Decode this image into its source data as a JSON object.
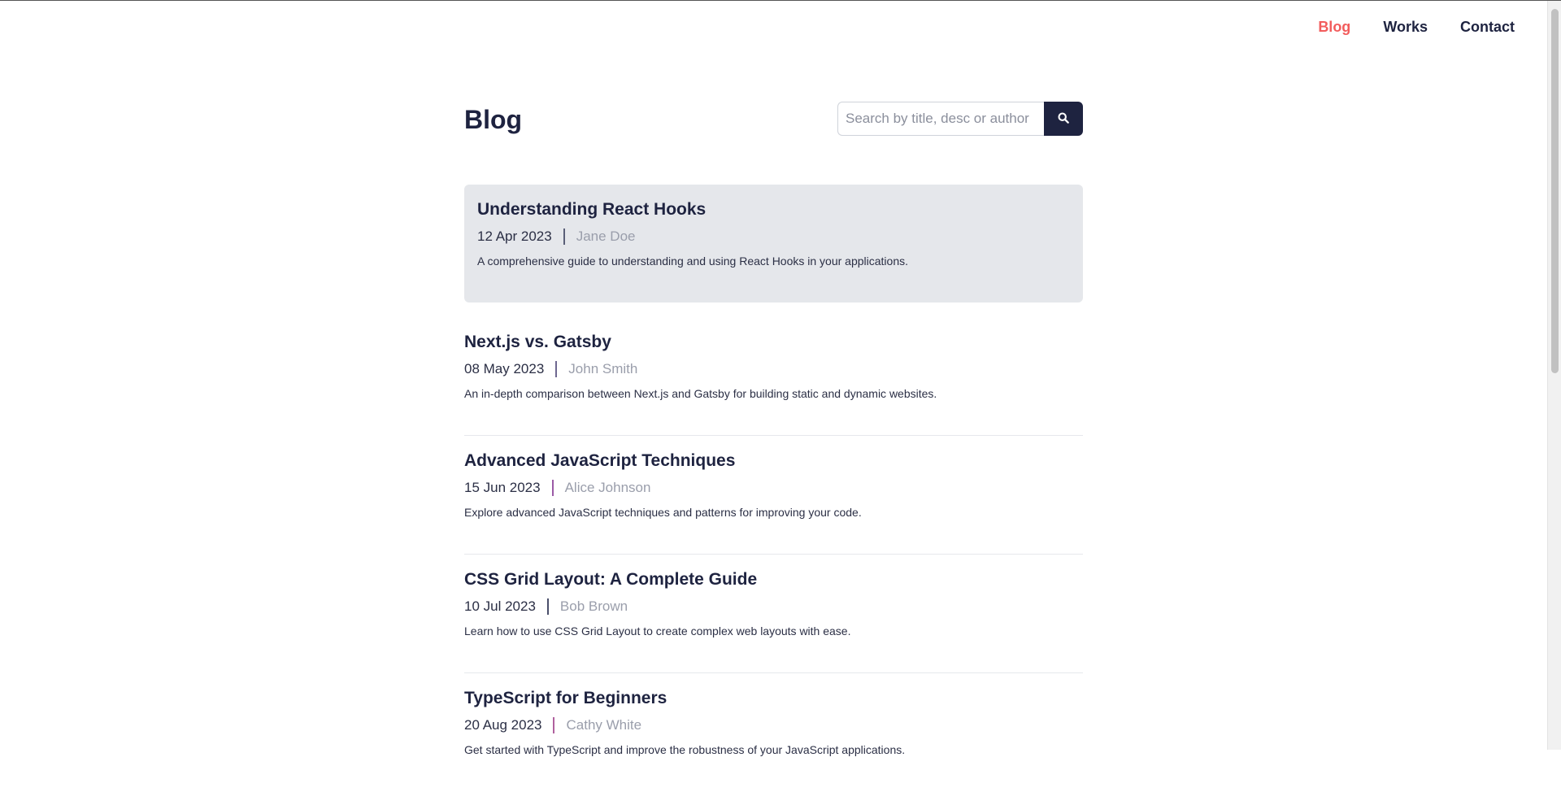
{
  "nav": {
    "items": [
      {
        "label": "Blog",
        "active": true
      },
      {
        "label": "Works",
        "active": false
      },
      {
        "label": "Contact",
        "active": false
      }
    ]
  },
  "page": {
    "title": "Blog"
  },
  "search": {
    "placeholder": "Search by title, desc or author",
    "value": "",
    "icon": "search-icon"
  },
  "posts": [
    {
      "title": "Understanding React Hooks",
      "date": "12 Apr 2023",
      "author": "Jane Doe",
      "description": "A comprehensive guide to understanding and using React Hooks in your applications.",
      "separator_color": "#5a5f78"
    },
    {
      "title": "Next.js vs. Gatsby",
      "date": "08 May 2023",
      "author": "John Smith",
      "description": "An in-depth comparison between Next.js and Gatsby for building static and dynamic websites.",
      "separator_color": "#6e6790"
    },
    {
      "title": "Advanced JavaScript Techniques",
      "date": "15 Jun 2023",
      "author": "Alice Johnson",
      "description": "Explore advanced JavaScript techniques and patterns for improving your code.",
      "separator_color": "#9b5aa6"
    },
    {
      "title": "CSS Grid Layout: A Complete Guide",
      "date": "10 Jul 2023",
      "author": "Bob Brown",
      "description": "Learn how to use CSS Grid Layout to create complex web layouts with ease.",
      "separator_color": "#4a4f6a"
    },
    {
      "title": "TypeScript for Beginners",
      "date": "20 Aug 2023",
      "author": "Cathy White",
      "description": "Get started with TypeScript and improve the robustness of your JavaScript applications.",
      "separator_color": "#b0609e"
    }
  ],
  "colors": {
    "accent": "#f25c5c",
    "primary": "#1e2340",
    "featured_bg": "#e5e7eb",
    "muted": "#9a9eab"
  }
}
